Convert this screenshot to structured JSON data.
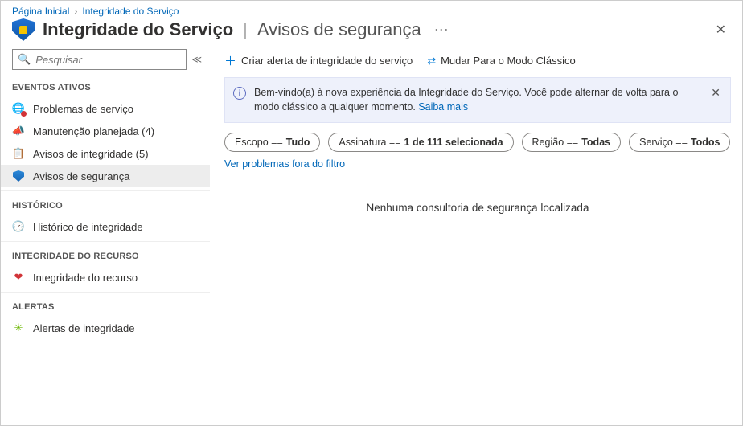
{
  "breadcrumb": {
    "home": "Página Inicial",
    "current": "Integridade do Serviço"
  },
  "title": {
    "main": "Integridade do Serviço",
    "sub": "Avisos de segurança"
  },
  "search": {
    "placeholder": "Pesquisar"
  },
  "sidebar": {
    "sections": {
      "active_events": "EVENTOS ATIVOS",
      "history": "HISTÓRICO",
      "resource_health": "INTEGRIDADE DO RECURSO",
      "alerts": "ALERTAS"
    },
    "items": {
      "service_issues": "Problemas de serviço",
      "planned_maintenance": "Manutenção planejada (4)",
      "health_advisories": "Avisos de integridade (5)",
      "security_advisories": "Avisos de segurança",
      "health_history": "Histórico de integridade",
      "resource_health": "Integridade do recurso",
      "health_alerts": "Alertas de integridade"
    }
  },
  "commands": {
    "create_alert": "Criar alerta de integridade do serviço",
    "switch_classic": "Mudar Para o Modo Clássico"
  },
  "banner": {
    "text_before": "Bem-vindo(a) à nova experiência da Integridade do Serviço. Você pode alternar de volta para o modo clássico a qualquer momento. ",
    "link": "Saiba mais"
  },
  "filters": {
    "scope_label": "Escopo == ",
    "scope_value": "Tudo",
    "sub_label": "Assinatura == ",
    "sub_value": "1 de 111 selecionada",
    "region_label": "Região == ",
    "region_value": "Todas",
    "service_label": "Serviço == ",
    "service_value": "Todos"
  },
  "links": {
    "outside_filter": "Ver problemas fora do filtro"
  },
  "empty": "Nenhuma consultoria de segurança localizada"
}
